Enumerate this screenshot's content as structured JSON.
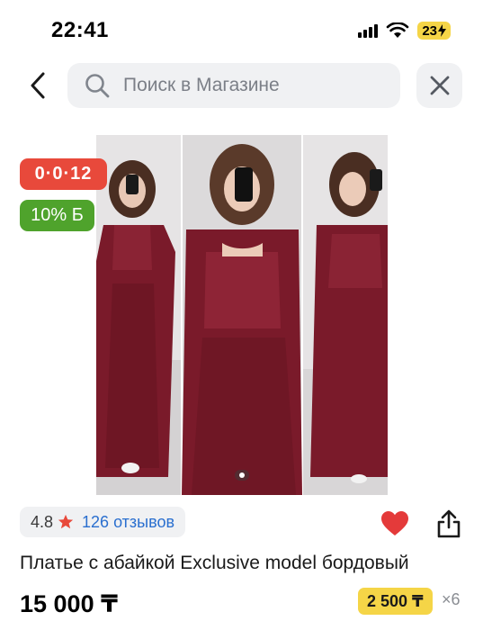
{
  "status_bar": {
    "time": "22:41",
    "battery": "23"
  },
  "search": {
    "placeholder": "Поиск в Магазине",
    "value": ""
  },
  "badges": {
    "installment": "0·0·12",
    "bonus": "10% Б"
  },
  "rating": {
    "value": "4.8",
    "reviews": "126 отзывов"
  },
  "product": {
    "title": "Платье с абайкой Exclusive model бордовый",
    "price": "15 000 ₸",
    "installment_price": "2 500 ₸",
    "installment_months": "×6"
  },
  "colors": {
    "accent_red": "#e8493b",
    "bonus_green": "#4fa32c",
    "installment_yellow": "#f5d547",
    "link_blue": "#2a6fcf",
    "outfit_burgundy": "#7a1a2a"
  },
  "icons": {
    "back": "chevron-left-icon",
    "search": "magnifier-icon",
    "close": "close-icon",
    "star": "star-icon",
    "favorite": "heart-icon",
    "share": "share-icon"
  }
}
